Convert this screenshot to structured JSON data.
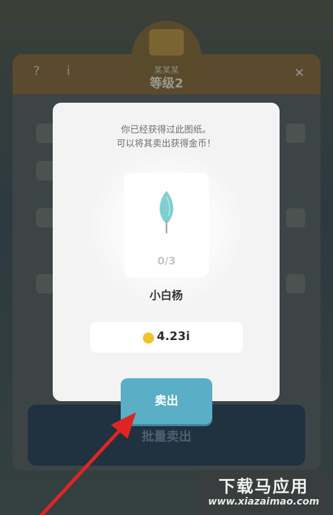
{
  "background": {
    "help": "?",
    "info": "i",
    "close": "×",
    "subtitle": "某某某",
    "title": "等级2",
    "bulk_sell_label": "批量卖出"
  },
  "modal": {
    "message_line1": "你已经获得过此图纸。",
    "message_line2": "可以将其卖出获得金币！",
    "item_icon": "poplar-leaf-icon",
    "progress": "0/3",
    "item_name": "小白杨",
    "currency_icon": "gold-coin-icon",
    "price": "4.23i",
    "sell_label": "卖出"
  },
  "watermark": {
    "title": "下载马应用",
    "url": "www.xiazaimao.com"
  },
  "colors": {
    "sell_button": "#5aaec6",
    "coin": "#f3c12a",
    "arrow": "#e02424"
  }
}
